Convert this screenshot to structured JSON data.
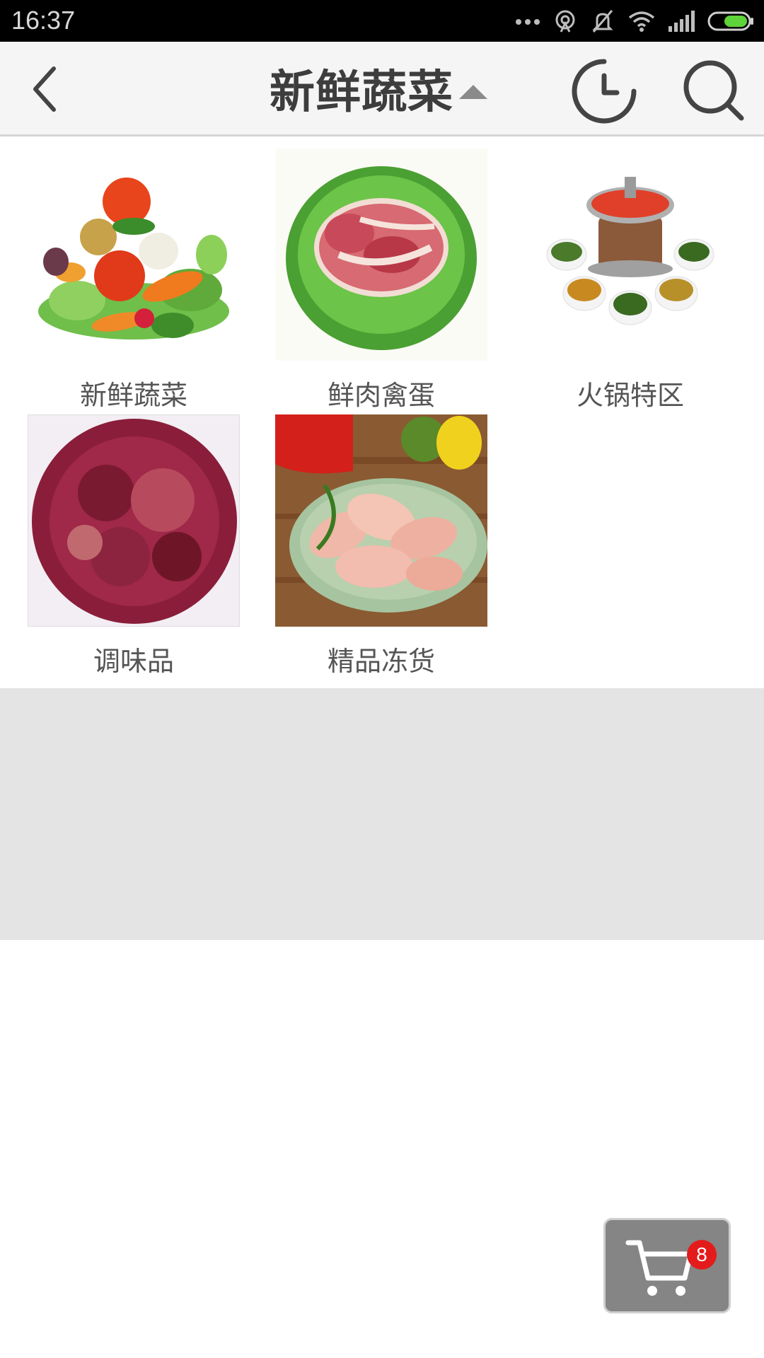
{
  "status_bar": {
    "time": "16:37",
    "icons": [
      "more-dots-icon",
      "hotspot-icon",
      "mute-icon",
      "wifi-icon",
      "signal-icon",
      "battery-icon"
    ]
  },
  "header": {
    "title": "新鲜蔬菜",
    "back_icon": "chevron-left-icon",
    "history_icon": "clock-icon",
    "search_icon": "search-icon"
  },
  "categories": [
    {
      "label": "新鲜蔬菜",
      "image": "vegetables"
    },
    {
      "label": "鲜肉禽蛋",
      "image": "pork-on-lettuce"
    },
    {
      "label": "火锅特区",
      "image": "hotpot"
    },
    {
      "label": "调味品",
      "image": "sichuan-peppercorns"
    },
    {
      "label": "精品冻货",
      "image": "chicken-drumsticks"
    }
  ],
  "cart": {
    "icon": "cart-icon",
    "count": "8"
  },
  "colors": {
    "status_bar_bg": "#000000",
    "nav_bg": "#f5f5f5",
    "gray_band": "#e4e4e4",
    "cart_bg": "#858585",
    "badge": "#e41b1b",
    "battery": "#5ed33a"
  }
}
